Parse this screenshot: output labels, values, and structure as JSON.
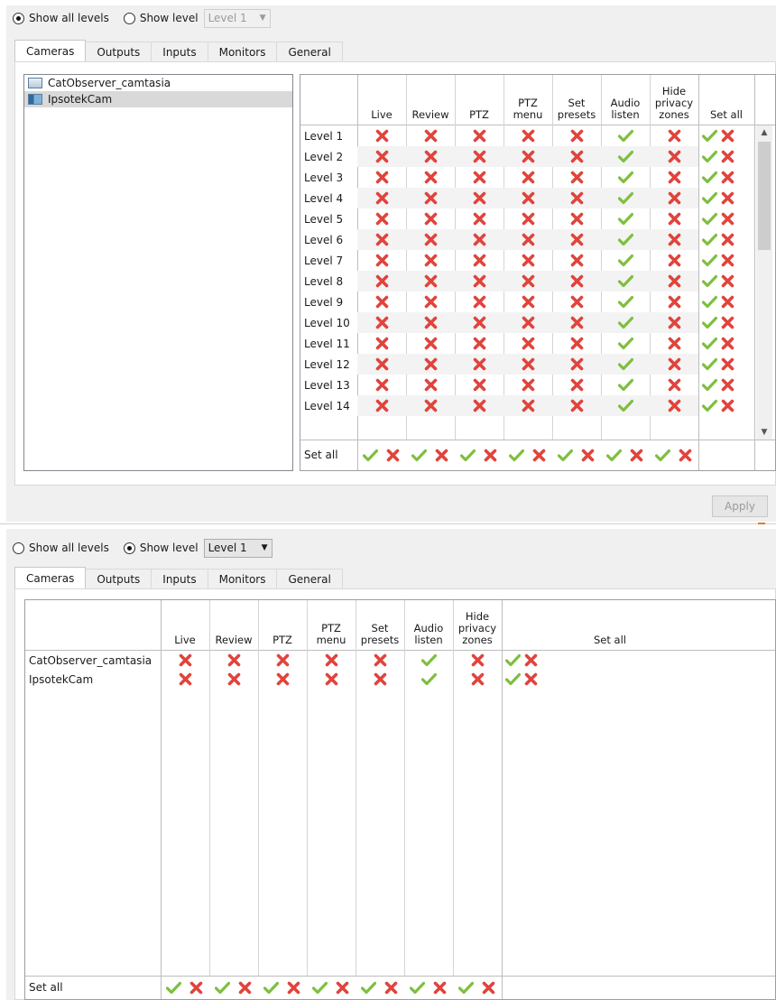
{
  "top": {
    "radio_all": "Show all levels",
    "radio_level": "Show level",
    "level_select": "Level 1",
    "tabs": [
      "Cameras",
      "Outputs",
      "Inputs",
      "Monitors",
      "General"
    ],
    "camera_list": [
      "CatObserver_camtasia",
      "IpsotekCam"
    ],
    "columns": [
      "Live",
      "Review",
      "PTZ",
      "PTZ menu",
      "Set presets",
      "Audio listen",
      "Hide privacy zones"
    ],
    "set_all_header": "Set all",
    "rows": [
      "Level 1",
      "Level 2",
      "Level 3",
      "Level 4",
      "Level 5",
      "Level 6",
      "Level 7",
      "Level 8",
      "Level 9",
      "Level 10",
      "Level 11",
      "Level 12",
      "Level 13",
      "Level 14"
    ],
    "row_values": [
      false,
      false,
      false,
      false,
      false,
      true,
      false
    ],
    "set_all_row": "Set all",
    "apply": "Apply"
  },
  "bottom": {
    "radio_all": "Show all levels",
    "radio_level": "Show level",
    "level_select": "Level 1",
    "tabs": [
      "Cameras",
      "Outputs",
      "Inputs",
      "Monitors",
      "General"
    ],
    "columns": [
      "Live",
      "Review",
      "PTZ",
      "PTZ menu",
      "Set presets",
      "Audio listen",
      "Hide privacy zones"
    ],
    "set_all_header": "Set all",
    "rows": [
      "CatObserver_camtasia",
      "IpsotekCam"
    ],
    "row_values": [
      false,
      false,
      false,
      false,
      false,
      true,
      false
    ],
    "set_all_row": "Set all"
  },
  "colors": {
    "check": "#7fbf3f",
    "cross": "#e0443c",
    "panel": "#f0f0f0"
  }
}
